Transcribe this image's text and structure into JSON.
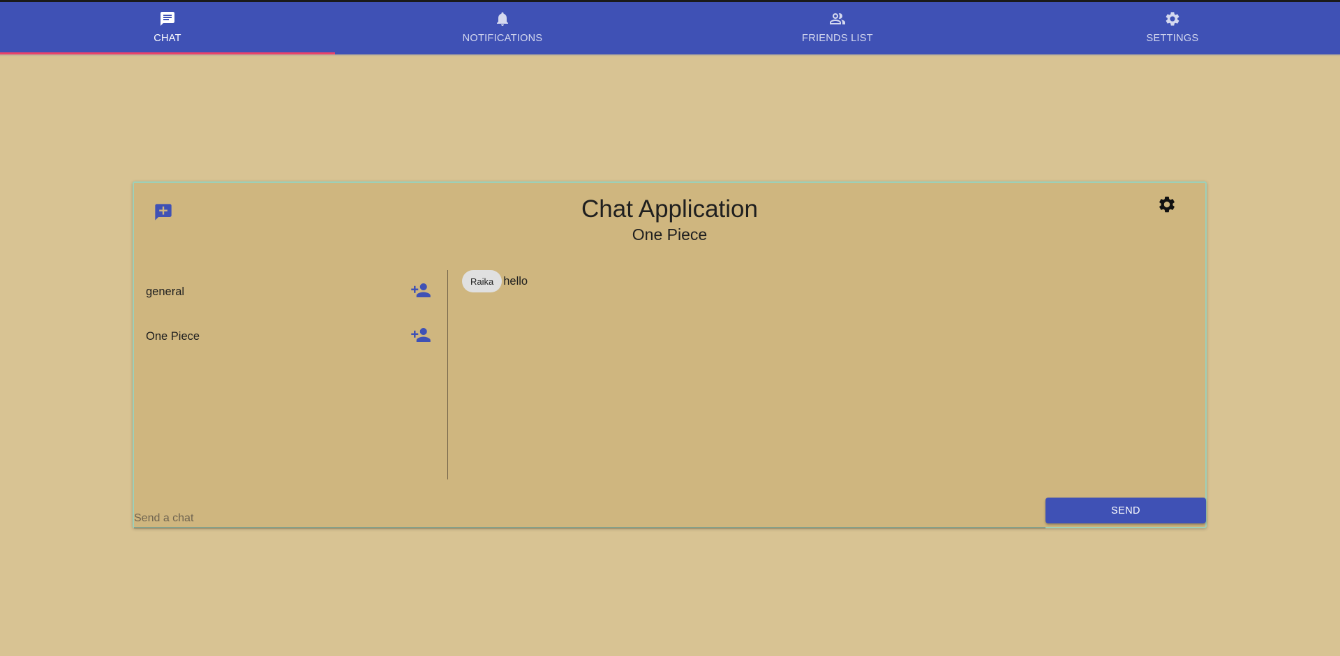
{
  "nav": {
    "tabs": [
      {
        "label": "CHAT",
        "icon": "chat-icon",
        "active": true
      },
      {
        "label": "NOTIFICATIONS",
        "icon": "bell-icon",
        "active": false
      },
      {
        "label": "FRIENDS LIST",
        "icon": "people-icon",
        "active": false
      },
      {
        "label": "SETTINGS",
        "icon": "gear-icon",
        "active": false
      }
    ]
  },
  "chat": {
    "title": "Chat Application",
    "subtitle": "One Piece",
    "rooms": [
      {
        "name": "general"
      },
      {
        "name": "One Piece"
      }
    ],
    "messages": [
      {
        "sender": "Raika",
        "text": "hello"
      }
    ],
    "input": {
      "placeholder": "Send a chat",
      "value": ""
    },
    "send_label": "SEND"
  },
  "colors": {
    "primary": "#3f51b5",
    "page_background": "#d8c393",
    "card_background": "#cfb67f",
    "tab_indicator": "#e9426b"
  }
}
